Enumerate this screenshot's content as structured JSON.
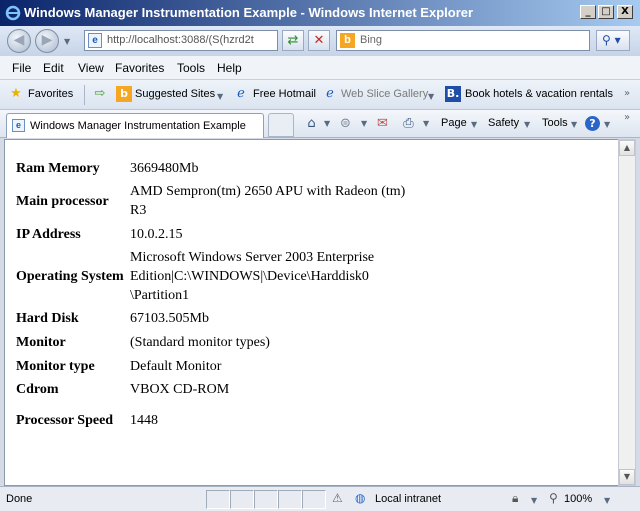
{
  "window": {
    "title": "Windows Manager Instrumentation Example - Windows Internet Explorer",
    "minimize": "_",
    "maximize": "□",
    "close": "X"
  },
  "address_bar": {
    "url": "http://localhost:3088/(S(hzrd2t",
    "search_placeholder": "Bing"
  },
  "menu": {
    "items": [
      "File",
      "Edit",
      "View",
      "Favorites",
      "Tools",
      "Help"
    ]
  },
  "favorites_bar": {
    "favorites_label": "Favorites",
    "suggested_sites": "Suggested Sites",
    "free_hotmail": "Free Hotmail",
    "web_slice_gallery": "Web Slice Gallery",
    "book_hotels": "Book hotels & vacation rentals"
  },
  "command_bar": {
    "tab_title": "Windows Manager Instrumentation Example",
    "page": "Page",
    "safety": "Safety",
    "tools": "Tools"
  },
  "system_info": {
    "rows": [
      {
        "label": "Ram Memory",
        "value": "3669480Mb"
      },
      {
        "label": "Main processor",
        "value": "AMD Sempron(tm) 2650 APU with Radeon (tm) R3"
      },
      {
        "label": "IP Address",
        "value": "10.0.2.15"
      },
      {
        "label": "Operating System",
        "value": "Microsoft Windows Server 2003 Enterprise Edition|C:\\WINDOWS|\\Device\\Harddisk0 \\Partition1"
      },
      {
        "label": "Hard Disk",
        "value": "67103.505Mb"
      },
      {
        "label": "Monitor",
        "value": "(Standard monitor types)"
      },
      {
        "label": "Monitor type",
        "value": "Default Monitor"
      },
      {
        "label": "Cdrom",
        "value": "VBOX CD-ROM"
      },
      {
        "label": "Processor Speed",
        "value": "1448"
      }
    ]
  },
  "status_bar": {
    "status": "Done",
    "zone": "Local intranet",
    "zoom": "100%"
  },
  "icons": {
    "back": "back-arrow-icon",
    "forward": "forward-arrow-icon",
    "refresh": "refresh-icon",
    "stop": "stop-icon",
    "search": "search-icon",
    "home": "home-icon",
    "feeds": "rss-icon",
    "mail": "mail-icon",
    "print": "print-icon",
    "help": "help-icon"
  }
}
